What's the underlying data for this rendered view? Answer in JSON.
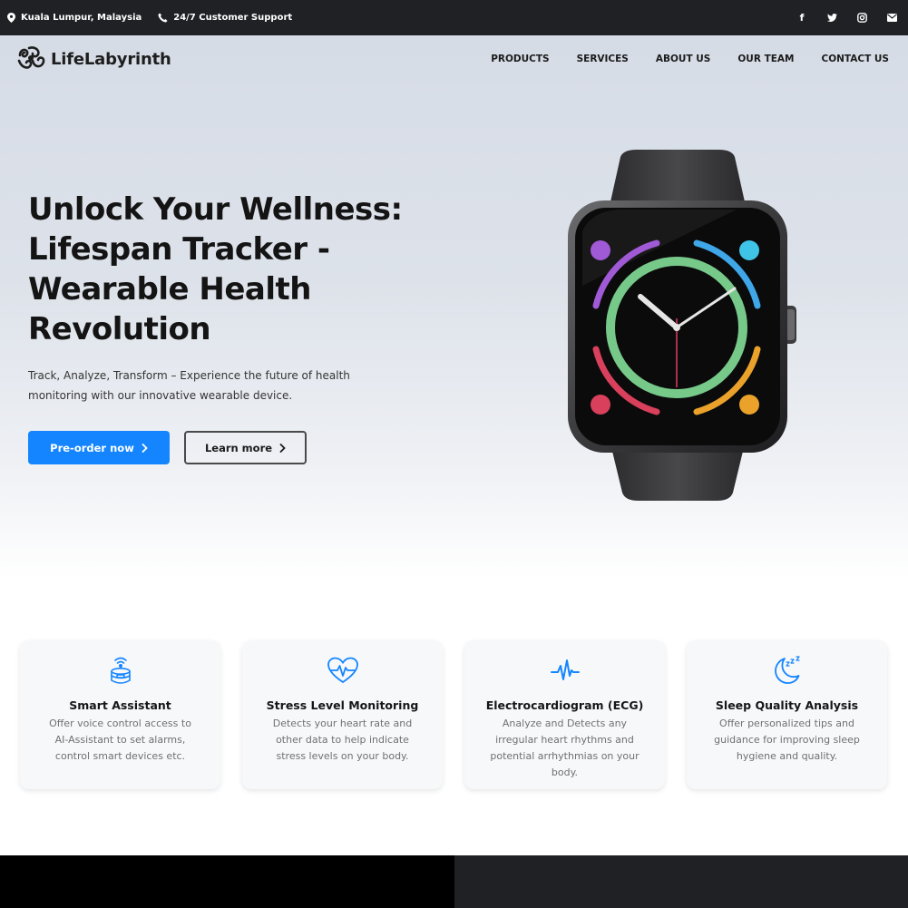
{
  "topbar": {
    "location": "Kuala Lumpur, Malaysia",
    "support": "24/7 Customer Support",
    "socials": [
      {
        "icon": "facebook-icon",
        "glyph": "f"
      },
      {
        "icon": "twitter-icon",
        "glyph": "t"
      },
      {
        "icon": "instagram-icon",
        "glyph": "◎"
      },
      {
        "icon": "email-icon",
        "glyph": "✉"
      }
    ]
  },
  "nav": {
    "brand": "LifeLabyrinth",
    "items": [
      "PRODUCTS",
      "SERVICES",
      "ABOUT US",
      "OUR TEAM",
      "CONTACT US"
    ]
  },
  "hero": {
    "title_lines": [
      "Unlock Your Wellness:",
      "Lifespan Tracker -",
      "Wearable Health",
      "Revolution"
    ],
    "subtitle_lines": [
      "Track, Analyze, Transform – Experience the future of health",
      "monitoring with our innovative wearable device."
    ],
    "primary_label": "Pre-order now",
    "secondary_label": "Learn more"
  },
  "features": [
    {
      "icon": "assistant-icon",
      "title": "Smart Assistant",
      "lines": [
        "Offer voice control access to",
        "AI-Assistant to set alarms,",
        "control smart devices etc."
      ]
    },
    {
      "icon": "heart-pulse-icon",
      "title": "Stress Level Monitoring",
      "lines": [
        "Detects your heart rate and",
        "other data to help indicate",
        "stress levels on your body."
      ]
    },
    {
      "icon": "ecg-icon",
      "title": "Electrocardiogram (ECG)",
      "lines": [
        "Analyze and Detects any",
        "irregular heart rhythms and",
        "potential arrhythmias on your",
        "body."
      ]
    },
    {
      "icon": "moon-sleep-icon",
      "title": "Sleep Quality Analysis",
      "lines": [
        "Offer personalized tips and",
        "guidance for improving sleep",
        "hygiene and quality."
      ]
    }
  ],
  "colors": {
    "accent": "#1485ff",
    "topbar": "#1f2125"
  }
}
